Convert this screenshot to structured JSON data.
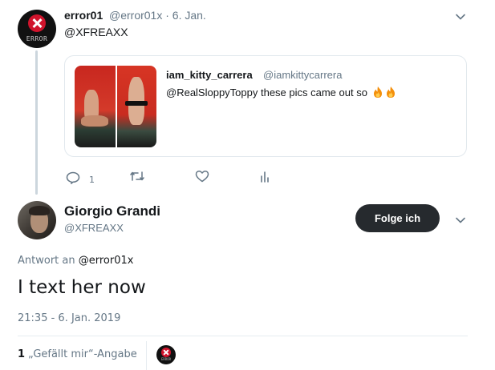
{
  "parent_tweet": {
    "display_name": "error01",
    "meta": "@error01x · 6. Jan.",
    "avatar_text": "ERROR",
    "avatar_icon": "x-circle-icon",
    "text": "@XFREAXX",
    "quoted": {
      "display_name": "iam_kitty_carrera",
      "handle": "@iamkittycarrera",
      "text": "@RealSloppyToppy  these pics came out so",
      "emoji": [
        "fire-icon",
        "fire-icon"
      ]
    },
    "actions": {
      "reply_count": "1",
      "icons": [
        "reply-icon",
        "retweet-icon",
        "like-icon",
        "analytics-icon"
      ]
    }
  },
  "focus_tweet": {
    "display_name": "Giorgio Grandi",
    "handle": "@XFREAXX",
    "follow_label": "Folge ich",
    "replying_prefix": "Antwort an",
    "replying_to": "@error01x",
    "text": "I text her now",
    "timestamp": "21:35 - 6. Jan. 2019",
    "likes": {
      "count": "1",
      "label": "„Gefällt mir“-Angabe"
    }
  },
  "colors": {
    "secondary_text": "#657786",
    "border": "#e1e8ed",
    "button_dark": "#262a2e",
    "error_red": "#d0142c"
  }
}
